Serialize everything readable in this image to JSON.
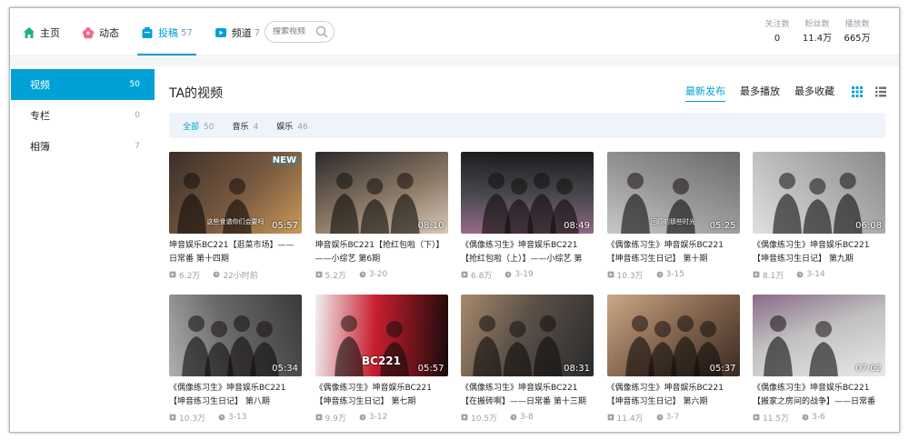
{
  "nav": {
    "items": [
      {
        "label": "主页",
        "count": "",
        "icon": "home-icon",
        "color": "#1cb37c"
      },
      {
        "label": "动态",
        "count": "",
        "icon": "flower-icon",
        "color": "#f36b8e"
      },
      {
        "label": "投稿",
        "count": "57",
        "icon": "upload-icon",
        "color": "#00a1d6",
        "active": true
      },
      {
        "label": "频道",
        "count": "7",
        "icon": "channel-icon",
        "color": "#00a1d6"
      }
    ]
  },
  "search": {
    "placeholder": "搜索视频"
  },
  "stats": [
    {
      "label": "关注数",
      "value": "0"
    },
    {
      "label": "粉丝数",
      "value": "11.4万"
    },
    {
      "label": "播放数",
      "value": "665万"
    }
  ],
  "sidebar": {
    "items": [
      {
        "label": "视频",
        "count": "50",
        "active": true
      },
      {
        "label": "专栏",
        "count": "0"
      },
      {
        "label": "相簿",
        "count": "7"
      }
    ]
  },
  "main": {
    "title": "TA的视频",
    "sorts": [
      {
        "label": "最新发布",
        "active": true
      },
      {
        "label": "最多播放"
      },
      {
        "label": "最多收藏"
      }
    ],
    "filters": [
      {
        "label": "全部",
        "count": "50",
        "active": true
      },
      {
        "label": "音乐",
        "count": "4"
      },
      {
        "label": "娱乐",
        "count": "46"
      }
    ]
  },
  "videos": [
    {
      "title": "坤音娱乐BC221【逛菜市场】——日常番 第十四期",
      "duration": "05:57",
      "plays": "6.2万",
      "time": "22小时前",
      "badge": "NEW",
      "caption": "这些食谱你们会要吗",
      "palette": [
        "#3a2f2a",
        "#7a5a40",
        "#c89a5a"
      ]
    },
    {
      "title": "坤音娱乐BC221【抢红包啦（下）】——小综艺 第6期",
      "duration": "08:10",
      "plays": "5.2万",
      "time": "3-20",
      "badge": "",
      "caption": "",
      "palette": [
        "#2c2a2a",
        "#8a7866",
        "#d8c8b8"
      ]
    },
    {
      "title": "《偶像练习生》坤音娱乐BC221【抢红包啦（上）】——小综艺 第",
      "duration": "08:49",
      "plays": "6.8万",
      "time": "3-19",
      "badge": "",
      "caption": "",
      "palette": [
        "#1a1a1e",
        "#4a4a50",
        "#9a6a8a"
      ]
    },
    {
      "title": "《偶像练习生》坤音娱乐BC221【坤音练习生日记】 第十期",
      "duration": "05:25",
      "plays": "10.3万",
      "time": "3-15",
      "badge": "",
      "caption": "回顾的那些时光",
      "palette": [
        "#6a6a6a",
        "#9a9a9a",
        "#c8c8c8"
      ]
    },
    {
      "title": "《偶像练习生》坤音娱乐BC221【坤音练习生日记】 第九期",
      "duration": "06:08",
      "plays": "8.1万",
      "time": "3-14",
      "badge": "",
      "caption": "",
      "palette": [
        "#8a8a8a",
        "#b8b8b8",
        "#e0e0e0"
      ]
    },
    {
      "title": "《偶像练习生》坤音娱乐BC221【坤音练习生日记】 第八期",
      "duration": "05:34",
      "plays": "10.3万",
      "time": "3-13",
      "badge": "",
      "caption": "",
      "palette": [
        "#3a3a3a",
        "#6a6a6a",
        "#b0b0b0"
      ]
    },
    {
      "title": "《偶像练习生》坤音娱乐BC221【坤音练习生日记】 第七期",
      "duration": "05:57",
      "plays": "9.9万",
      "time": "3-12",
      "badge": "",
      "caption": "BC221",
      "palette": [
        "#1a0a0a",
        "#c81e2e",
        "#f0f0f0"
      ]
    },
    {
      "title": "《偶像练习生》坤音娱乐BC221【在搬砖啊】——日常番 第十三期",
      "duration": "08:31",
      "plays": "10.5万",
      "time": "3-8",
      "badge": "",
      "caption": "",
      "palette": [
        "#2a2a2a",
        "#5a5048",
        "#a88a6a"
      ]
    },
    {
      "title": "《偶像练习生》坤音娱乐BC221【坤音练习生日记】 第六期",
      "duration": "05:37",
      "plays": "11.4万",
      "time": "3-7",
      "badge": "",
      "caption": "",
      "palette": [
        "#3a2a22",
        "#8a6a52",
        "#caa888"
      ]
    },
    {
      "title": "《偶像练习生》坤音娱乐BC221【搬家之房间的战争】——日常番",
      "duration": "07:02",
      "plays": "11.5万",
      "time": "3-6",
      "badge": "",
      "caption": "",
      "palette": [
        "#e8e8e8",
        "#c0c0c0",
        "#8a6a8a"
      ]
    }
  ],
  "colors": {
    "accent": "#00a1d6",
    "muted": "#99a2aa",
    "filter_bg": "#eef4f9"
  }
}
